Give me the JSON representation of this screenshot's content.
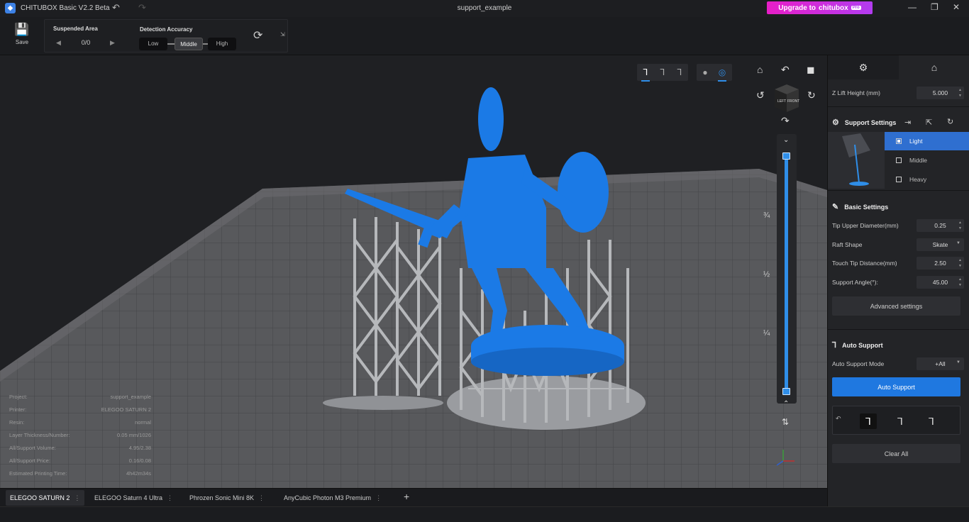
{
  "titlebar": {
    "app_title": "CHITUBOX Basic V2.2 Beta",
    "doc_title": "support_example",
    "upgrade_label": "Upgrade to",
    "upgrade_brand": "chitubox",
    "upgrade_badge": "Pro",
    "upgrade_color": "#e81ec7"
  },
  "toolbar": {
    "save_label": "Save",
    "suspended_area_label": "Suspended Area",
    "suspended_area_value": "0/0",
    "detection_accuracy_label": "Detection Accuracy",
    "accuracy_options": [
      "Low",
      "Middle",
      "High"
    ],
    "accuracy_selected": "Middle"
  },
  "viewport": {
    "navcube_left": "LEFT",
    "navcube_front": "FRONT",
    "slider_marks": [
      "¾",
      "½",
      "¼"
    ],
    "accent_color": "#2f8ee8",
    "model_color": "#1b7ae6"
  },
  "info": [
    {
      "label": "Project:",
      "value": "support_example"
    },
    {
      "label": "Printer:",
      "value": "ELEGOO SATURN 2"
    },
    {
      "label": "Resin:",
      "value": "normal"
    },
    {
      "label": "Layer Thickness/Number:",
      "value": "0.05 mm/1026"
    },
    {
      "label": "All/Support Volume:",
      "value": "4.95/2.38"
    },
    {
      "label": "All/Support Price:",
      "value": "0.16/0.08"
    },
    {
      "label": "Estimated Printing Time:",
      "value": "4h42m34s"
    }
  ],
  "printer_tabs": [
    "ELEGOO SATURN 2",
    "ELEGOO Saturn 4 Ultra",
    "Phrozen Sonic Mini 8K",
    "AnyCubic Photon M3 Premium"
  ],
  "panel": {
    "z_lift_label": "Z Lift Height (mm)",
    "z_lift_value": "5.000",
    "support_settings_label": "Support Settings",
    "presets": [
      "Light",
      "Middle",
      "Heavy"
    ],
    "preset_selected": "Light",
    "basic_settings_label": "Basic Settings",
    "tip_upper_label": "Tip Upper Diameter(mm)",
    "tip_upper_value": "0.25",
    "raft_shape_label": "Raft Shape",
    "raft_shape_value": "Skate",
    "touch_tip_label": "Touch Tip Distance(mm)",
    "touch_tip_value": "2.50",
    "support_angle_label": "Support Angle(°):",
    "support_angle_value": "45.00",
    "advanced_label": "Advanced settings",
    "auto_support_label": "Auto Support",
    "auto_mode_label": "Auto Support Mode",
    "auto_mode_value": "+All",
    "auto_support_button": "Auto Support",
    "clear_all_button": "Clear All"
  }
}
